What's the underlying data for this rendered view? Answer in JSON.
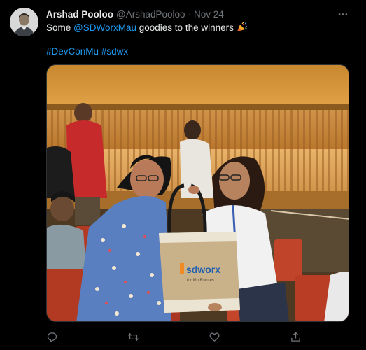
{
  "tweet": {
    "display_name": "Arshad Pooloo",
    "handle": "@ArshadPooloo",
    "separator": "·",
    "timestamp": "Nov 24",
    "text_before": "Some ",
    "mention": "@SDWorxMau",
    "text_after": " goodies to the winners",
    "hashtags": [
      "#DevConMu",
      "#sdwx"
    ],
    "emoji": "party-popper-icon"
  },
  "media": {
    "bag_logo_text": "sdworx",
    "bag_tagline": "for Mu Futures"
  },
  "actions": {
    "icons": [
      "reply-icon",
      "retweet-icon",
      "like-icon",
      "share-icon"
    ]
  },
  "colors": {
    "background": "#000000",
    "text": "#e7e9ea",
    "secondary": "#71767b",
    "accent": "#1d9bf0"
  }
}
